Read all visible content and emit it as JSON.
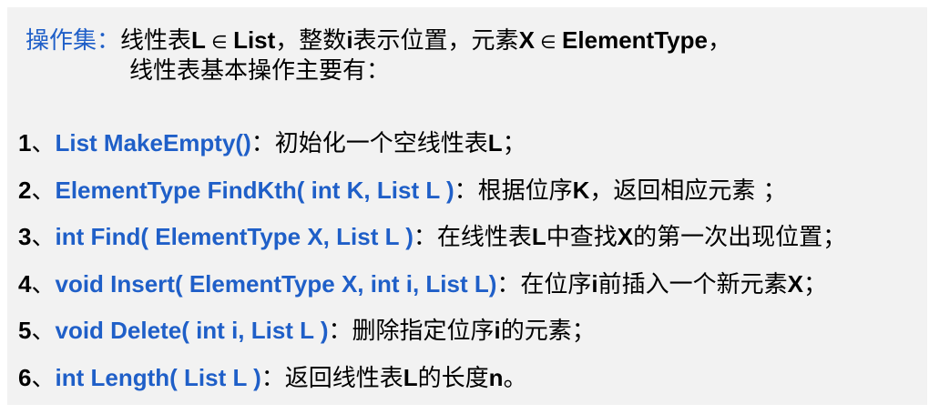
{
  "header": {
    "label": "操作集：",
    "seg1": "线性表",
    "l": "L",
    "in1": " ∈ ",
    "list": "List",
    "seg2": "，整数",
    "i": "i",
    "seg3": "表示位置，元素",
    "x": "X",
    "in2": " ∈ ",
    "etype": "ElementType",
    "seg4": "，",
    "line2": "线性表基本操作主要有："
  },
  "operations": [
    {
      "num": "1",
      "sep": "、",
      "sig": "List MakeEmpty()",
      "parts": [
        {
          "t": "：初始化一个空线性表",
          "b": false
        },
        {
          "t": "L",
          "b": true
        },
        {
          "t": "；",
          "b": false
        }
      ]
    },
    {
      "num": "2",
      "sep": "、",
      "sig": "ElementType FindKth( int K, List L )",
      "parts": [
        {
          "t": "：根据位序",
          "b": false
        },
        {
          "t": "K",
          "b": true
        },
        {
          "t": "，返回相应元素 ；",
          "b": false
        }
      ]
    },
    {
      "num": "3",
      "sep": "、",
      "sig": "int Find( ElementType X, List L )",
      "parts": [
        {
          "t": "：在线性表",
          "b": false
        },
        {
          "t": "L",
          "b": true
        },
        {
          "t": "中查找",
          "b": false
        },
        {
          "t": "X",
          "b": true
        },
        {
          "t": "的第一次出现位置；",
          "b": false
        }
      ]
    },
    {
      "num": "4",
      "sep": "、",
      "sig": "void Insert( ElementType X, int i, List L)",
      "parts": [
        {
          "t": "：在位序",
          "b": false
        },
        {
          "t": "i",
          "b": true
        },
        {
          "t": "前插入一个新元素",
          "b": false
        },
        {
          "t": "X",
          "b": true
        },
        {
          "t": "；",
          "b": false
        }
      ]
    },
    {
      "num": "5",
      "sep": "、",
      "sig": "void Delete( int  i, List L )",
      "parts": [
        {
          "t": "：删除指定位序",
          "b": false
        },
        {
          "t": "i",
          "b": true
        },
        {
          "t": "的元素；",
          "b": false
        }
      ]
    },
    {
      "num": "6",
      "sep": "、",
      "sig": "int Length( List L )",
      "parts": [
        {
          "t": "：返回线性表",
          "b": false
        },
        {
          "t": "L",
          "b": true
        },
        {
          "t": "的长度",
          "b": false
        },
        {
          "t": "n",
          "b": true
        },
        {
          "t": "。",
          "b": false
        }
      ]
    }
  ],
  "colors": {
    "blue": "#1f5fc8",
    "panel": "#f2f2f2",
    "text": "#000000"
  }
}
